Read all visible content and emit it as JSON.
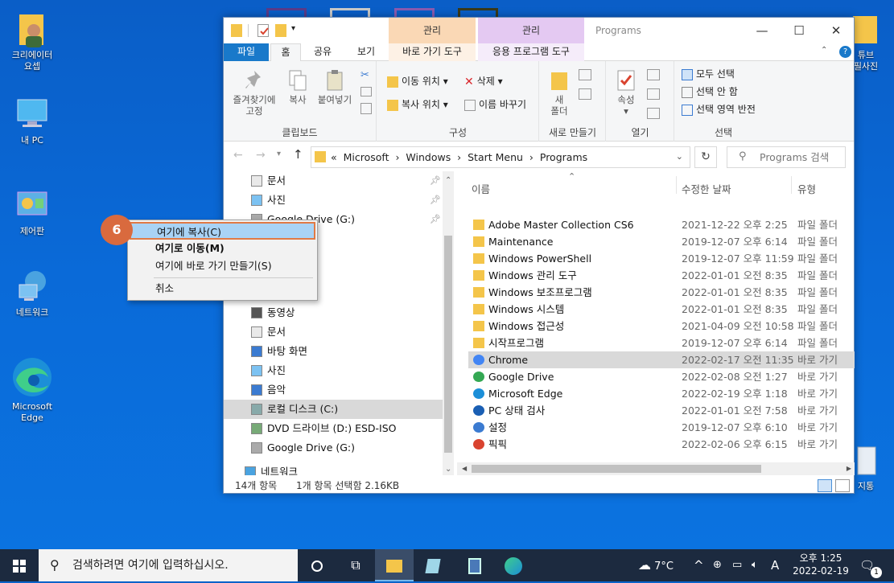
{
  "desktop": {
    "icons": [
      {
        "label": "크리에이터\n요셉"
      },
      {
        "label": "내 PC"
      },
      {
        "label": "제어판"
      },
      {
        "label": "네트워크"
      },
      {
        "label": "Microsoft\nEdge"
      },
      {
        "label": "튜브\n필사진"
      },
      {
        "label": "지통"
      }
    ]
  },
  "window": {
    "context_tab_1": "관리",
    "context_tab_2": "관리",
    "context_sub_1": "바로 가기 도구",
    "context_sub_2": "응용 프로그램 도구",
    "title": "Programs",
    "tabs": [
      "파일",
      "홈",
      "공유",
      "보기"
    ],
    "ribbon": {
      "clipboard": {
        "pin": "즐겨찾기에\n고정",
        "copy": "복사",
        "paste": "붙여넣기",
        "label": "클립보드"
      },
      "organize": {
        "move": "이동 위치",
        "delete": "삭제",
        "copyto": "복사 위치",
        "rename": "이름 바꾸기",
        "label": "구성"
      },
      "new": {
        "newfolder": "새\n폴더",
        "label": "새로 만들기"
      },
      "open": {
        "props": "속성",
        "label": "열기"
      },
      "select": {
        "all": "모두 선택",
        "none": "선택 안 함",
        "invert": "선택 영역 반전",
        "label": "선택"
      }
    },
    "breadcrumb": [
      "«",
      "Microsoft",
      "Windows",
      "Start Menu",
      "Programs"
    ],
    "search_placeholder": "Programs 검색",
    "nav": [
      {
        "label": "문서",
        "pinned": true
      },
      {
        "label": "사진",
        "pinned": true
      },
      {
        "label": "Google Drive (G:)",
        "pinned": true
      },
      {
        "label": "동영상"
      },
      {
        "label": "문서"
      },
      {
        "label": "바탕 화면"
      },
      {
        "label": "사진"
      },
      {
        "label": "음악"
      },
      {
        "label": "로컬 디스크 (C:)",
        "selected": true
      },
      {
        "label": "DVD 드라이브 (D:) ESD-ISO"
      },
      {
        "label": "Google Drive (G:)"
      },
      {
        "label": "네트워크"
      }
    ],
    "columns": {
      "name": "이름",
      "date": "수정한 날짜",
      "type": "유형"
    },
    "files": [
      {
        "name": "Adobe Master Collection CS6",
        "date": "2021-12-22 오후 2:25",
        "type": "파일 폴더",
        "kind": "folder"
      },
      {
        "name": "Maintenance",
        "date": "2019-12-07 오후 6:14",
        "type": "파일 폴더",
        "kind": "folder"
      },
      {
        "name": "Windows PowerShell",
        "date": "2019-12-07 오후 11:59",
        "type": "파일 폴더",
        "kind": "folder"
      },
      {
        "name": "Windows 관리 도구",
        "date": "2022-01-01 오전 8:35",
        "type": "파일 폴더",
        "kind": "folder"
      },
      {
        "name": "Windows 보조프로그램",
        "date": "2022-01-01 오전 8:35",
        "type": "파일 폴더",
        "kind": "folder"
      },
      {
        "name": "Windows 시스템",
        "date": "2022-01-01 오전 8:35",
        "type": "파일 폴더",
        "kind": "folder"
      },
      {
        "name": "Windows 접근성",
        "date": "2021-04-09 오전 10:58",
        "type": "파일 폴더",
        "kind": "folder"
      },
      {
        "name": "시작프로그램",
        "date": "2019-12-07 오후 6:14",
        "type": "파일 폴더",
        "kind": "folder"
      },
      {
        "name": "Chrome",
        "date": "2022-02-17 오전 11:35",
        "type": "바로 가기",
        "kind": "chrome",
        "selected": true
      },
      {
        "name": "Google Drive",
        "date": "2022-02-08 오전 1:27",
        "type": "바로 가기",
        "kind": "gdrive"
      },
      {
        "name": "Microsoft Edge",
        "date": "2022-02-19 오후 1:18",
        "type": "바로 가기",
        "kind": "edge"
      },
      {
        "name": "PC 상태 검사",
        "date": "2022-01-01 오전 7:58",
        "type": "바로 가기",
        "kind": "pchealth"
      },
      {
        "name": "설정",
        "date": "2019-12-07 오후 6:10",
        "type": "바로 가기",
        "kind": "settings"
      },
      {
        "name": "픽픽",
        "date": "2022-02-06 오후 6:15",
        "type": "바로 가기",
        "kind": "picpick"
      }
    ],
    "status_count": "14개 항목",
    "status_selected": "1개 항목 선택함 2.16KB"
  },
  "context_menu": {
    "badge": "6",
    "items": [
      "여기에 복사(C)",
      "여기로 이동(M)",
      "여기에 바로 가기 만들기(S)",
      "취소"
    ]
  },
  "taskbar": {
    "search_placeholder": "검색하려면 여기에 입력하십시오.",
    "weather": "7°C",
    "ime": "A",
    "time": "오후 1:25",
    "date": "2022-02-19",
    "notif_count": "1"
  }
}
